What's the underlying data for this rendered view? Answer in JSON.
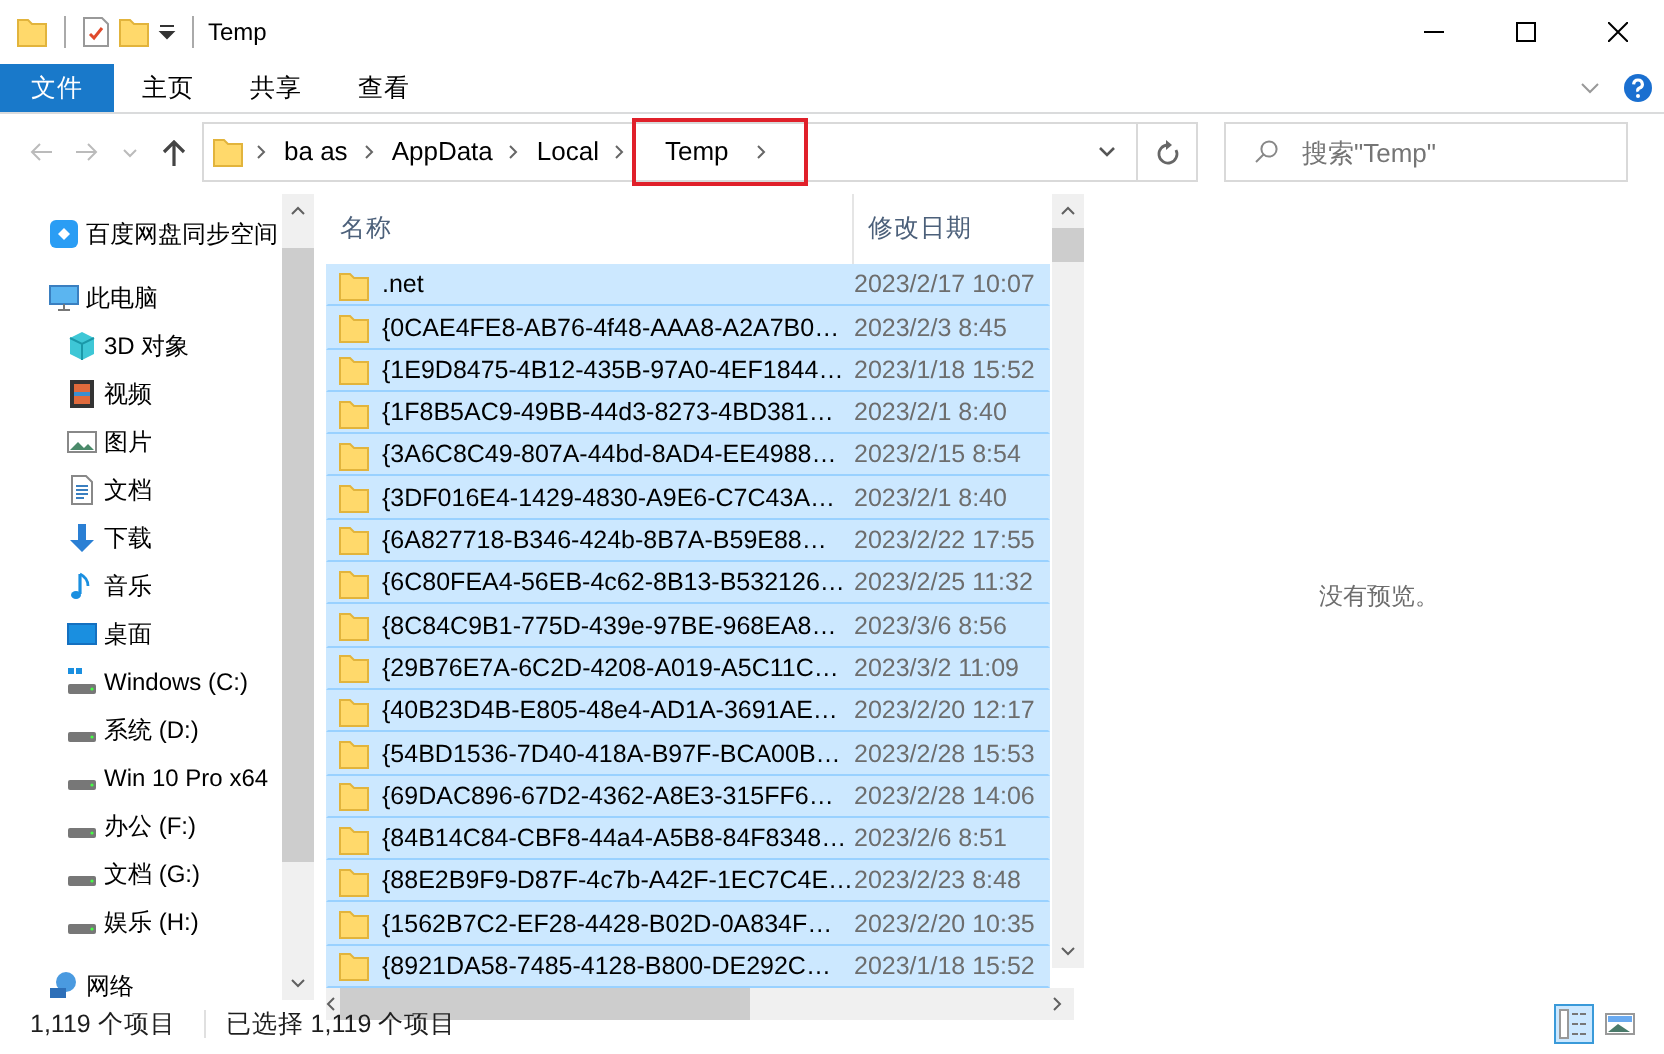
{
  "window": {
    "title": "Temp"
  },
  "ribbon_tabs": [
    {
      "label": "文件",
      "kind": "file",
      "selected": false
    },
    {
      "label": "主页",
      "kind": "tab",
      "selected": false
    },
    {
      "label": "共享",
      "kind": "tab",
      "selected": false
    },
    {
      "label": "查看",
      "kind": "tab",
      "selected": false
    }
  ],
  "address": {
    "crumbs": [
      {
        "label": "ba as",
        "highlighted": false
      },
      {
        "label": "AppData",
        "highlighted": false
      },
      {
        "label": "Local",
        "highlighted": false
      },
      {
        "label": "Temp",
        "highlighted": true
      }
    ]
  },
  "search": {
    "placeholder": "搜索\"Temp\""
  },
  "sidebar": {
    "items": [
      {
        "label": "百度网盘同步空间",
        "kind": "cloud"
      },
      {
        "label": "此电脑",
        "kind": "computer",
        "children": [
          {
            "label": "3D 对象",
            "kind": "cube"
          },
          {
            "label": "视频",
            "kind": "video"
          },
          {
            "label": "图片",
            "kind": "picture"
          },
          {
            "label": "文档",
            "kind": "document"
          },
          {
            "label": "下载",
            "kind": "download"
          },
          {
            "label": "音乐",
            "kind": "music"
          },
          {
            "label": "桌面",
            "kind": "desktop"
          },
          {
            "label": "Windows (C:)",
            "kind": "system-drive"
          },
          {
            "label": "系统 (D:)",
            "kind": "drive"
          },
          {
            "label": "Win 10 Pro x64",
            "kind": "drive"
          },
          {
            "label": "办公 (F:)",
            "kind": "drive"
          },
          {
            "label": "文档 (G:)",
            "kind": "drive"
          },
          {
            "label": "娱乐 (H:)",
            "kind": "drive"
          }
        ]
      },
      {
        "label": "网络",
        "kind": "network"
      }
    ]
  },
  "table": {
    "columns": [
      "名称",
      "修改日期"
    ],
    "rows": [
      {
        "name": ".net",
        "date": "2023/2/17 10:07",
        "selected": true
      },
      {
        "name": "{0CAE4FE8-AB76-4f48-AAA8-A2A7B0…",
        "date": "2023/2/3 8:45",
        "selected": true
      },
      {
        "name": "{1E9D8475-4B12-435B-97A0-4EF1844…",
        "date": "2023/1/18 15:52",
        "selected": true
      },
      {
        "name": "{1F8B5AC9-49BB-44d3-8273-4BD381…",
        "date": "2023/2/1 8:40",
        "selected": true
      },
      {
        "name": "{3A6C8C49-807A-44bd-8AD4-EE4988…",
        "date": "2023/2/15 8:54",
        "selected": true
      },
      {
        "name": "{3DF016E4-1429-4830-A9E6-C7C43A…",
        "date": "2023/2/1 8:40",
        "selected": true
      },
      {
        "name": "{6A827718-B346-424b-8B7A-B59E88…",
        "date": "2023/2/22 17:55",
        "selected": true
      },
      {
        "name": "{6C80FEA4-56EB-4c62-8B13-B532126…",
        "date": "2023/2/25 11:32",
        "selected": true
      },
      {
        "name": "{8C84C9B1-775D-439e-97BE-968EA8…",
        "date": "2023/3/6 8:56",
        "selected": true
      },
      {
        "name": "{29B76E7A-6C2D-4208-A019-A5C11C…",
        "date": "2023/3/2 11:09",
        "selected": true
      },
      {
        "name": "{40B23D4B-E805-48e4-AD1A-3691AE…",
        "date": "2023/2/20 12:17",
        "selected": true
      },
      {
        "name": "{54BD1536-7D40-418A-B97F-BCA00B…",
        "date": "2023/2/28 15:53",
        "selected": true
      },
      {
        "name": "{69DAC896-67D2-4362-A8E3-315FF6…",
        "date": "2023/2/28 14:06",
        "selected": true
      },
      {
        "name": "{84B14C84-CBF8-44a4-A5B8-84F8348…",
        "date": "2023/2/6 8:51",
        "selected": true
      },
      {
        "name": "{88E2B9F9-D87F-4c7b-A42F-1EC7C4E…",
        "date": "2023/2/23 8:48",
        "selected": true
      },
      {
        "name": "{1562B7C2-EF28-4428-B02D-0A834F…",
        "date": "2023/2/20 10:35",
        "selected": true
      },
      {
        "name": "{8921DA58-7485-4128-B800-DE292C…",
        "date": "2023/1/18 15:52",
        "selected": true
      }
    ]
  },
  "preview": {
    "message": "没有预览。"
  },
  "status_bar": {
    "count": "1,119 个项目",
    "selection": "已选择 1,119 个项目"
  },
  "view_buttons": [
    {
      "kind": "details",
      "selected": true
    },
    {
      "kind": "large-icons",
      "selected": false
    }
  ]
}
